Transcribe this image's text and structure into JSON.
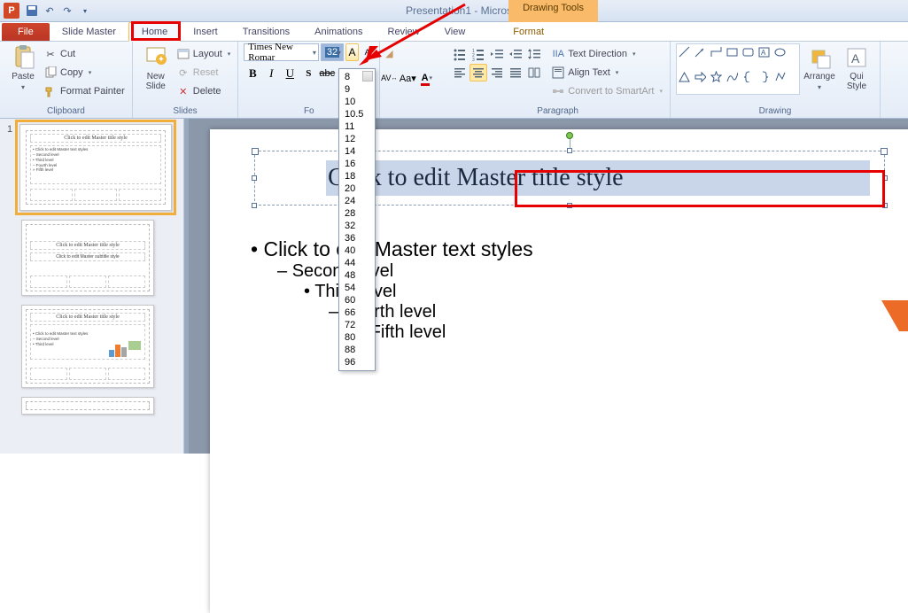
{
  "titlebar": {
    "app_letter": "P",
    "doc_title": "Presentation1 - Microsoft PowerPoint",
    "context_group": "Drawing Tools"
  },
  "tabs": {
    "file": "File",
    "slide_master": "Slide Master",
    "home": "Home",
    "insert": "Insert",
    "transitions": "Transitions",
    "animations": "Animations",
    "review": "Review",
    "view": "View",
    "format": "Format"
  },
  "ribbon": {
    "clipboard": {
      "paste": "Paste",
      "cut": "Cut",
      "copy": "Copy",
      "format_painter": "Format Painter",
      "label": "Clipboard"
    },
    "slides": {
      "new_slide": "New\nSlide",
      "layout": "Layout",
      "reset": "Reset",
      "delete": "Delete",
      "label": "Slides"
    },
    "font": {
      "name": "Times New Romar",
      "size": "32",
      "label": "Fo"
    },
    "paragraph": {
      "text_direction": "Text Direction",
      "align_text": "Align Text",
      "smartart": "Convert to SmartArt",
      "label": "Paragraph"
    },
    "drawing": {
      "arrange": "Arrange",
      "quick_styles": "Qui\nStyle",
      "label": "Drawing"
    }
  },
  "size_list": [
    "8",
    "9",
    "10",
    "10.5",
    "11",
    "12",
    "14",
    "16",
    "18",
    "20",
    "24",
    "28",
    "32",
    "36",
    "40",
    "44",
    "48",
    "54",
    "60",
    "66",
    "72",
    "80",
    "88",
    "96"
  ],
  "thumbs": {
    "master_title": "Click to edit Master title style",
    "bullets": "• Click to edit Master text styles\n   – Second level\n      • Third level\n         – Fourth level\n            » Fifth level",
    "layout1_title": "Click to edit Master title style",
    "layout1_sub": "Click to edit Master subtitle style",
    "layout2_title": "Click to edit Master title style",
    "layout2_bullets": "• Click to edit Master text styles\n   – Second level\n      • Third level"
  },
  "slide": {
    "title": "Click to edit Master title style",
    "b1": "Click to edit Master text styles",
    "b2": "Second level",
    "b3": "Third level",
    "b4": "Fourth level",
    "b5": "Fifth level"
  }
}
